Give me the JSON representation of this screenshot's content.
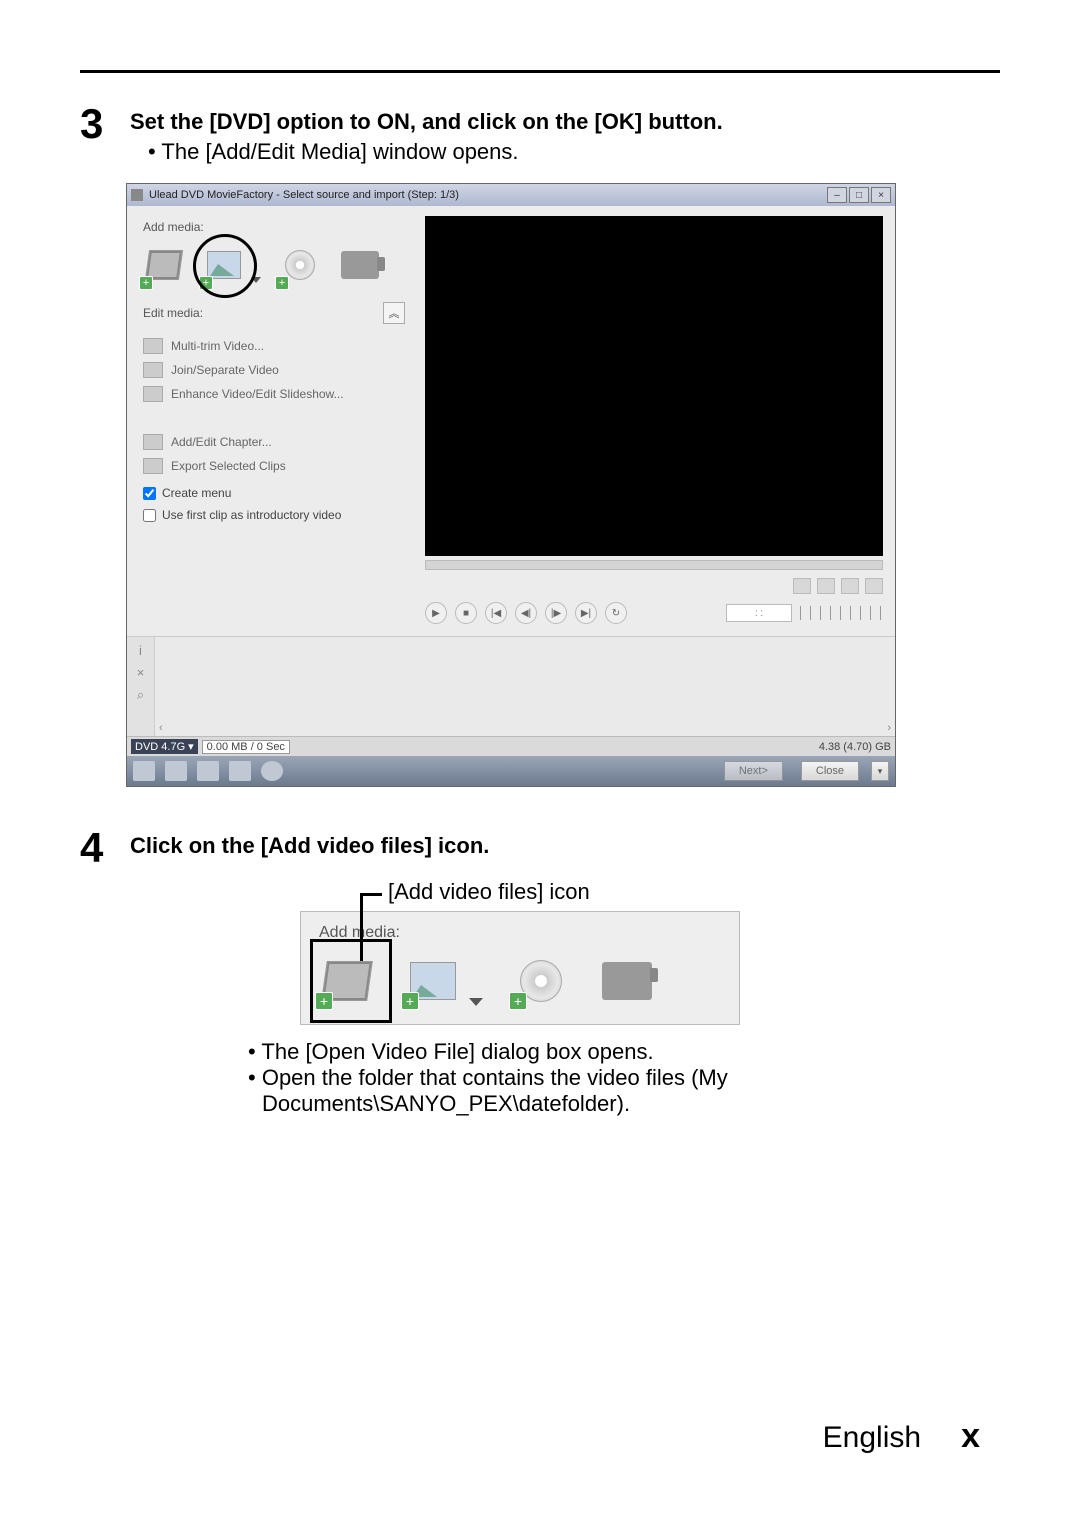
{
  "step3": {
    "number": "3",
    "title": "Set the [DVD] option to ON, and click on the [OK] button.",
    "bullet": "The [Add/Edit Media] window opens."
  },
  "window": {
    "title": "Ulead DVD MovieFactory - Select source and import (Step: 1/3)",
    "controls": {
      "min": "–",
      "max": "□",
      "close": "×"
    },
    "addMediaLabel": "Add media:",
    "editMediaLabel": "Edit media:",
    "collapseGlyph": "︽",
    "editItems": [
      "Multi-trim Video...",
      "Join/Separate Video",
      "Enhance Video/Edit Slideshow..."
    ],
    "editItems2": [
      "Add/Edit Chapter...",
      "Export Selected Clips"
    ],
    "createMenu": "Create menu",
    "useFirstClip": "Use first clip as introductory video",
    "timeBox": ":   :",
    "play": {
      "play": "▶",
      "stop": "■",
      "first": "|◀",
      "prev": "◀|",
      "next": "|▶",
      "last": "▶|",
      "repeat": "↻"
    },
    "sideIcons": {
      "info": "i",
      "del": "×",
      "search": "⌕"
    },
    "scroll": {
      "left": "‹",
      "right": "›"
    },
    "status": {
      "disc": "DVD 4.7G",
      "arrow": "▾",
      "used": "0.00 MB / 0 Sec",
      "total": "4.38 (4.70) GB"
    },
    "nav": {
      "next": "Next>",
      "close": "Close",
      "dd": "▾"
    }
  },
  "step4": {
    "number": "4",
    "title": "Click on the [Add video files] icon.",
    "callout": "[Add video files] icon",
    "panelLabel": "Add media:",
    "bullets": [
      "The [Open Video File] dialog box opens.",
      "Open the folder that contains the video files (My Documents\\SANYO_PEX\\datefolder)."
    ]
  },
  "footer": {
    "lang": "English",
    "page": "x"
  }
}
